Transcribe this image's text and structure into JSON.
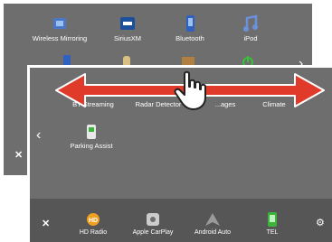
{
  "back_screen": {
    "apps": [
      {
        "label": "Wireless Mirroring",
        "icon": "wireless-mirroring-icon"
      },
      {
        "label": "SiriusXM",
        "icon": "siriusxm-icon"
      },
      {
        "label": "Bluetooth",
        "icon": "bluetooth-phone-icon"
      },
      {
        "label": "iPod",
        "icon": "ipod-icon"
      }
    ],
    "close_glyph": "✕",
    "next_glyph": "›"
  },
  "front_screen": {
    "apps": [
      {
        "label": "BT Streaming",
        "icon": "bt-streaming-icon"
      },
      {
        "label": "Radar Detector",
        "icon": "radar-detector-icon"
      },
      {
        "label": "...ages",
        "icon": "images-icon"
      },
      {
        "label": "Climate",
        "icon": "climate-icon"
      },
      {
        "label": "Parking Assist",
        "icon": "parking-assist-icon"
      }
    ],
    "prev_glyph": "‹",
    "dock": {
      "close_glyph": "✕",
      "items": [
        {
          "label": "HD Radio",
          "icon": "hd-radio-icon",
          "color": "#f0a020"
        },
        {
          "label": "Apple CarPlay",
          "icon": "apple-carplay-icon",
          "color": "#cccccc"
        },
        {
          "label": "Android Auto",
          "icon": "android-auto-icon",
          "color": "#9a9a9a"
        },
        {
          "label": "TEL",
          "icon": "tel-icon",
          "color": "#3cb43c"
        }
      ],
      "settings_glyph": "⚙"
    }
  },
  "gesture": {
    "arrow_color": "#e03a2a",
    "hint": "swipe-left-right"
  }
}
